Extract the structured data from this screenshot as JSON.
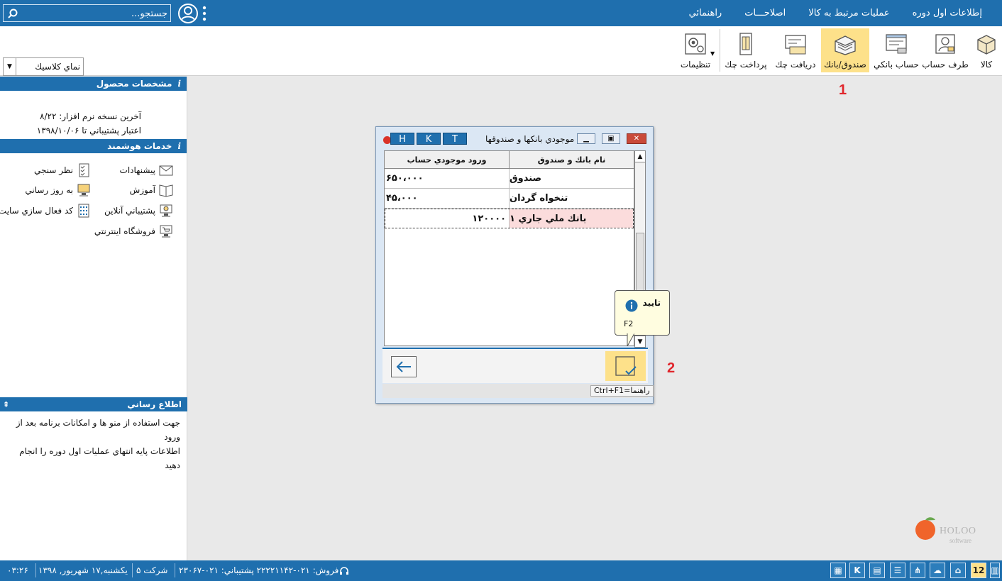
{
  "topbar": {
    "search_placeholder": "جستجو...",
    "menu": [
      "إطلاعات اول دوره",
      "عمليات مرتبط به كالا",
      "اصلاحـــات",
      "راهنمائي"
    ]
  },
  "ribbon": {
    "buttons": [
      {
        "label": "كالا",
        "icon": "product-box-icon"
      },
      {
        "label": "طرف حساب",
        "icon": "contact-icon"
      },
      {
        "label": "حساب بانكي",
        "icon": "bank-account-icon"
      },
      {
        "label": "صندوق/بانك",
        "icon": "cash-bank-icon",
        "active": true
      },
      {
        "label": "دريافت چك",
        "icon": "receive-cheque-icon"
      },
      {
        "label": "پرداخت چك",
        "icon": "pay-cheque-icon"
      },
      {
        "label": "تنظيمات",
        "icon": "settings-gear-icon"
      }
    ],
    "theme_select_value": "نماي كلاسيك"
  },
  "left_panel": {
    "product_header": "مشخصات محصول",
    "product_lines": [
      "آخرين نسخه نرم افزار: ۸/۲۲",
      "اعتبار پشتيباني تا ۱۳۹۸/۱۰/۰۶"
    ],
    "services_header": "خدمات هوشمند",
    "services": [
      {
        "label": "پيشنهادات",
        "icon": "mail-envelope-icon"
      },
      {
        "label": "نظر سنجي",
        "icon": "survey-checklist-icon"
      },
      {
        "label": "آموزش",
        "icon": "book-icon"
      },
      {
        "label": "به روز رساني",
        "icon": "update-download-icon"
      },
      {
        "label": "پشتيباني آنلاين",
        "icon": "online-support-icon"
      },
      {
        "label": "كد فعال سازي سايت",
        "icon": "keypad-icon"
      },
      {
        "label": "فروشگاه اينترنتي",
        "icon": "online-shop-icon"
      }
    ],
    "info_header": "اطلاع رساني",
    "info_lines": [
      "جهت استفاده از منو ها و امكانات برنامه بعد از ورود",
      "اطلاعات پايه انتهاي عمليات اول دوره را انجام دهيد"
    ]
  },
  "dialog": {
    "title": "موجودي بانكها و صندوقها",
    "hkt": [
      "H",
      "K",
      "T"
    ],
    "columns": {
      "amount": "ورود موجودي حساب",
      "name": "نام بانك و صندوق"
    },
    "rows": [
      {
        "name": "صندوق",
        "amount": "۶۵۰،۰۰۰"
      },
      {
        "name": "تنخواه گردان",
        "amount": "۴۵،۰۰۰"
      },
      {
        "name": "بانك ملي جاري ۱",
        "amount": "۱۲۰۰۰۰",
        "editing": true
      }
    ],
    "help_hint": "راهنما=Ctrl+F1"
  },
  "tooltip": {
    "title": "تاييد",
    "shortcut": "F2"
  },
  "annotations": [
    "1",
    "2"
  ],
  "logo": {
    "text": "HOLOO",
    "sub": "software"
  },
  "statusbar": {
    "time": "۰۳:۲۶",
    "date": "يكشنبه,۱۷ شهريور, ۱۳۹۸",
    "company": "شركت ۵",
    "phones": "فروش: ۰۲۱-۲۲۲۲۱۱۴۲  پشتيباني: ۰۲۱-۲۳۰۶۷",
    "calendar_day": "12"
  },
  "colors": {
    "accent_blue": "#1f6fae",
    "active_yellow": "#fde18a",
    "annotation_red": "#e0252b"
  }
}
